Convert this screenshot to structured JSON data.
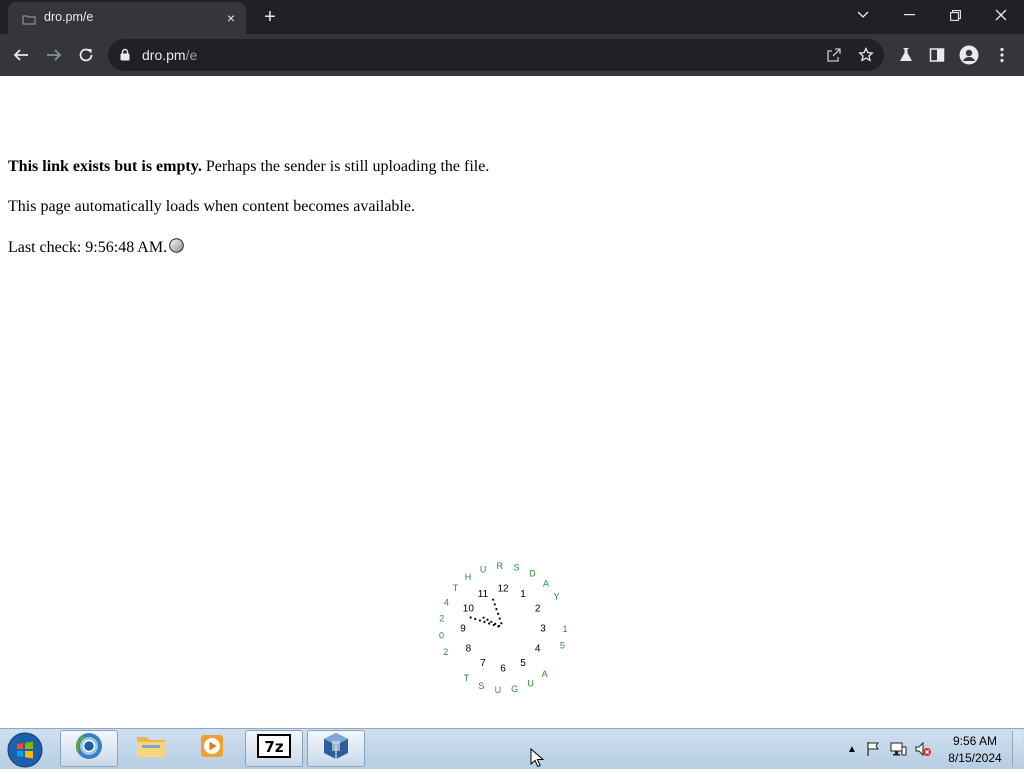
{
  "browser": {
    "tab_title": "dro.pm/e",
    "tab_close": "×",
    "new_tab": "+",
    "url_host": "dro.pm",
    "url_path": "/e"
  },
  "content": {
    "line1_bold": "This link exists but is empty.",
    "line1_rest": " Perhaps the sender is still uploading the file.",
    "line2": "This page automatically loads when content becomes available.",
    "line3": "Last check: 9:56:48 AM."
  },
  "clock": {
    "hours": [
      "12",
      "1",
      "2",
      "3",
      "4",
      "5",
      "6",
      "7",
      "8",
      "9",
      "10",
      "11"
    ],
    "ring_text": "THURSDAY 15 AUGUST 2024",
    "time": "9:56:48"
  },
  "taskbar": {
    "time": "9:56 AM",
    "date": "8/15/2024",
    "pinned": [
      "chrome",
      "explorer",
      "media-player",
      "7-zip",
      "virtualbox"
    ]
  },
  "colors": {
    "chrome_dark": "#202124",
    "chrome_tab": "#35363a",
    "clock_ring": "#2e8b3c",
    "taskbar": "#b7cde3"
  }
}
